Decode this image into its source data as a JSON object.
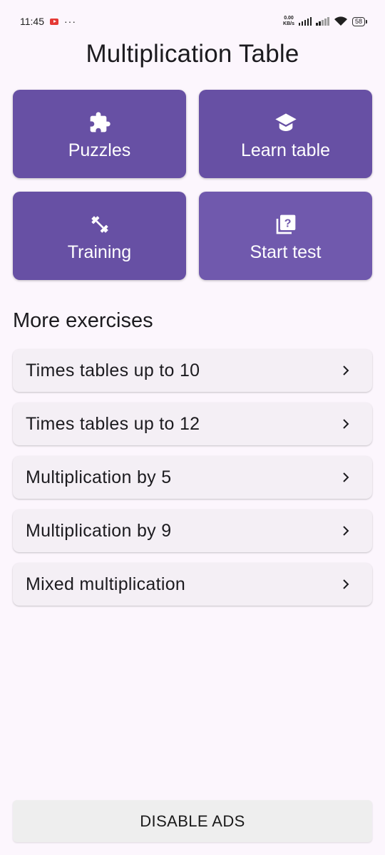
{
  "status_bar": {
    "time": "11:45",
    "dots": "···",
    "net_speed_value": "0.00",
    "net_speed_unit": "KB/s",
    "battery": "58"
  },
  "header": {
    "title": "Multiplication Table"
  },
  "tiles": [
    {
      "label": "Puzzles",
      "icon": "puzzle-icon"
    },
    {
      "label": "Learn table",
      "icon": "graduation-cap-icon"
    },
    {
      "label": "Training",
      "icon": "dumbbell-icon"
    },
    {
      "label": "Start test",
      "icon": "quiz-icon"
    }
  ],
  "more_exercises": {
    "title": "More exercises",
    "items": [
      {
        "label": "Times tables up to 10"
      },
      {
        "label": "Times tables up to 12"
      },
      {
        "label": "Multiplication by 5"
      },
      {
        "label": "Multiplication by 9"
      },
      {
        "label": "Mixed multiplication"
      }
    ]
  },
  "footer": {
    "disable_ads_label": "DISABLE ADS"
  },
  "colors": {
    "background": "#fcf6fd",
    "tile": "#6750a4",
    "list_item": "#f4eff5",
    "button": "#eeeeee"
  }
}
